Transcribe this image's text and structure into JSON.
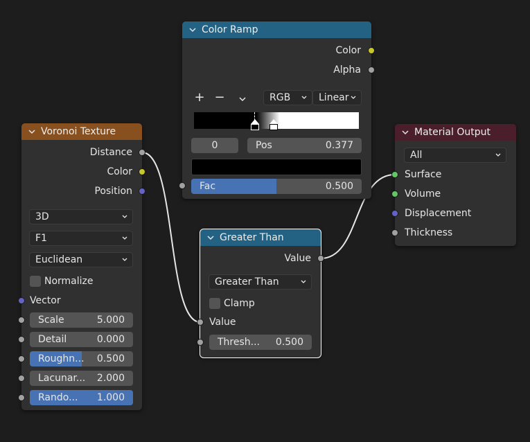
{
  "nodes": {
    "color_ramp": {
      "title": "Color Ramp",
      "outputs": [
        "Color",
        "Alpha"
      ],
      "toolbar": {
        "add": "+",
        "remove": "−",
        "menu": "⌄"
      },
      "color_mode": "RGB",
      "interpolation": "Linear",
      "stop_index": "0",
      "pos_label": "Pos",
      "pos_value": "0.377",
      "fac_label": "Fac",
      "fac_value": "0.500",
      "fac_fraction": 0.5
    },
    "voronoi": {
      "title": "Voronoi Texture",
      "outputs": [
        "Distance",
        "Color",
        "Position"
      ],
      "dimensions": "3D",
      "feature": "F1",
      "distance_metric": "Euclidean",
      "normalize_label": "Normalize",
      "vector_label": "Vector",
      "inputs": [
        {
          "label": "Scale",
          "value": "5.000",
          "fraction": 0
        },
        {
          "label": "Detail",
          "value": "0.000",
          "fraction": 0
        },
        {
          "label": "Roughn...",
          "value": "0.500",
          "fraction": 0.5
        },
        {
          "label": "Lacunar...",
          "value": "2.000",
          "fraction": 0
        },
        {
          "label": "Rando...",
          "value": "1.000",
          "fraction": 1.0
        }
      ]
    },
    "greater_than": {
      "title": "Greater Than",
      "output": "Value",
      "operation": "Greater Than",
      "clamp_label": "Clamp",
      "input_label": "Value",
      "threshold_label": "Thresh...",
      "threshold_value": "0.500"
    },
    "material_output": {
      "title": "Material Output",
      "target": "All",
      "inputs": [
        "Surface",
        "Volume",
        "Displacement",
        "Thickness"
      ]
    }
  },
  "colors": {
    "header_texture": "#88501f",
    "header_converter": "#246283",
    "header_output": "#4b1e2b",
    "wire": "#e6e6e6",
    "accent_blue": "#4772b3"
  }
}
